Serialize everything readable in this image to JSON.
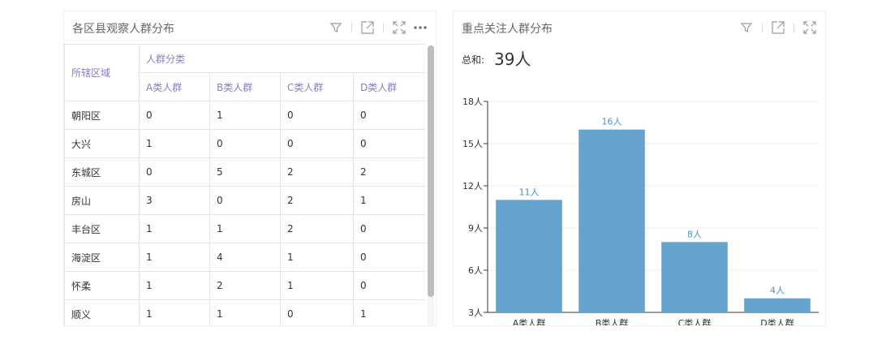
{
  "left_panel": {
    "title": "各区县观察人群分布",
    "table": {
      "row_header": "所辖区域",
      "group_header": "人群分类",
      "columns": [
        "A类人群",
        "B类人群",
        "C类人群",
        "D类人群"
      ],
      "rows": [
        {
          "region": "朝阳区",
          "values": [
            "0",
            "1",
            "0",
            "0"
          ]
        },
        {
          "region": "大兴",
          "values": [
            "1",
            "0",
            "0",
            "0"
          ]
        },
        {
          "region": "东城区",
          "values": [
            "0",
            "5",
            "2",
            "2"
          ]
        },
        {
          "region": "房山",
          "values": [
            "3",
            "0",
            "2",
            "1"
          ]
        },
        {
          "region": "丰台区",
          "values": [
            "1",
            "1",
            "2",
            "0"
          ]
        },
        {
          "region": "海淀区",
          "values": [
            "1",
            "4",
            "1",
            "0"
          ]
        },
        {
          "region": "怀柔",
          "values": [
            "1",
            "2",
            "1",
            "0"
          ]
        },
        {
          "region": "顺义",
          "values": [
            "1",
            "1",
            "0",
            "1"
          ]
        }
      ]
    },
    "icons": [
      "filter-icon",
      "export-icon",
      "expand-icon",
      "more-icon"
    ]
  },
  "right_panel": {
    "title": "重点关注人群分布",
    "sum_label": "总和:",
    "sum_value": "39人",
    "icons": [
      "filter-icon",
      "export-icon",
      "expand-icon"
    ]
  },
  "colors": {
    "bar": "#66a3cc",
    "label": "#4f8fbf",
    "header_text": "#8a7cc4"
  },
  "chart_data": {
    "type": "bar",
    "categories": [
      "A类人群",
      "B类人群",
      "C类人群",
      "D类人群"
    ],
    "values": [
      11,
      16,
      8,
      4
    ],
    "value_labels": [
      "11人",
      "16人",
      "8人",
      "4人"
    ],
    "ylim": [
      3,
      18
    ],
    "yticks": [
      3,
      6,
      9,
      12,
      15,
      18
    ],
    "ytick_labels": [
      "3人",
      "6人",
      "9人",
      "12人",
      "15人",
      "18人"
    ],
    "grid": true
  }
}
